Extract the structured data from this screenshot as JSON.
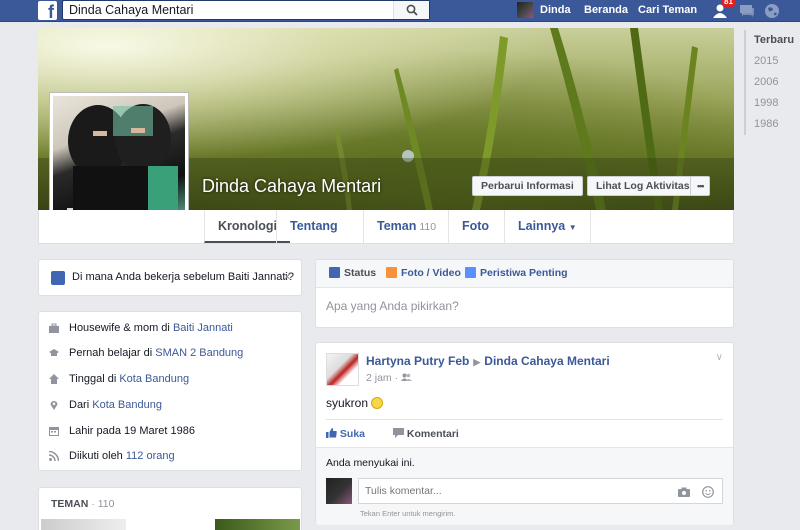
{
  "header": {
    "search_value": "Dinda Cahaya Mentari",
    "user_name": "Dinda",
    "home_label": "Beranda",
    "find_friends_label": "Cari Teman",
    "friend_requests_badge": "81"
  },
  "profile": {
    "name": "Dinda Cahaya Mentari",
    "update_info_label": "Perbarui Informasi",
    "activity_log_label": "Lihat Log Aktivitas",
    "more_label": "•••"
  },
  "tabs": [
    {
      "label": "Kronologi"
    },
    {
      "label": "Tentang"
    },
    {
      "label": "Teman",
      "count": "110"
    },
    {
      "label": "Foto"
    },
    {
      "label": "Lainnya"
    }
  ],
  "timeline_years": [
    "Terbaru",
    "2015",
    "2006",
    "1998",
    "1986"
  ],
  "work_question": {
    "text": "Di mana Anda bekerja sebelum Baiti Jannati?",
    "close": "×"
  },
  "intro": {
    "work": {
      "prefix": "Housewife & mom di ",
      "link": "Baiti Jannati"
    },
    "school": {
      "prefix": "Pernah belajar di ",
      "link": "SMAN 2 Bandung"
    },
    "lives": {
      "prefix": "Tinggal di ",
      "link": "Kota Bandung"
    },
    "from": {
      "prefix": "Dari ",
      "link": "Kota Bandung"
    },
    "birthday": {
      "text": "Lahir pada 19 Maret 1986"
    },
    "followers": {
      "prefix": "Diikuti oleh ",
      "link": "112 orang"
    }
  },
  "friends": {
    "title": "TEMAN",
    "separator": " · ",
    "count": "110"
  },
  "composer": {
    "status_label": "Status",
    "photo_label": "Foto / Video",
    "event_label": "Peristiwa Penting",
    "placeholder": "Apa yang Anda pikirkan?"
  },
  "post": {
    "author": "Hartyna Putry Feb",
    "target": "Dinda Cahaya Mentari",
    "time": "2 jam",
    "text": "syukron",
    "like_label": "Suka",
    "comment_label": "Komentari",
    "likes_text": "Anda menyukai ini.",
    "comment_placeholder": "Tulis komentar...",
    "comment_hint": "Tekan Enter untuk mengirim."
  },
  "colors": {
    "brand": "#3b5998",
    "page_bg": "#e9eaed",
    "link": "#3b5998",
    "muted": "#90949c"
  },
  "icons": [
    "facebook-logo",
    "search-icon",
    "friends-icon",
    "messages-icon",
    "globe-icon",
    "camera-icon",
    "briefcase-icon",
    "graduation-cap-icon",
    "house-icon",
    "location-pin-icon",
    "calendar-icon",
    "rss-icon",
    "pencil-icon",
    "photo-icon",
    "flag-icon",
    "thumbs-up-icon",
    "comment-icon",
    "emoji-icon"
  ]
}
